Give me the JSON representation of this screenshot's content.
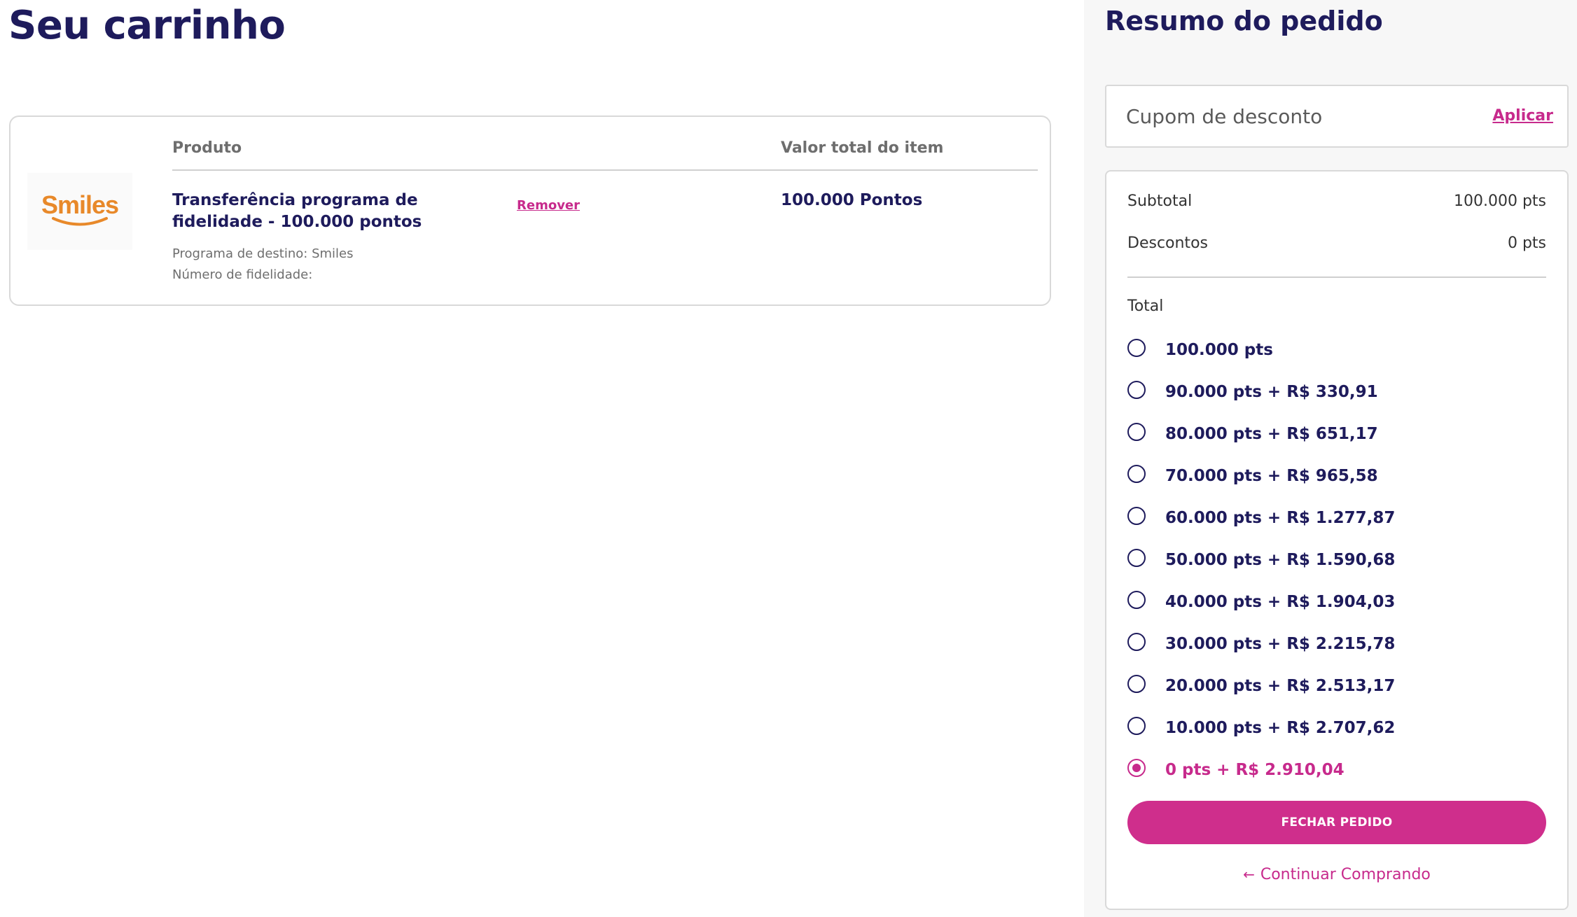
{
  "cart": {
    "title": "Seu carrinho",
    "headers": {
      "product": "Produto",
      "value": "Valor total do item"
    },
    "item": {
      "logo_text": "Smiles",
      "name": "Transferência programa de fidelidade - 100.000 pontos",
      "remove_label": "Remover",
      "value": "100.000 Pontos",
      "destination": "Programa de destino: Smiles",
      "loyalty_number": "Número de fidelidade:"
    }
  },
  "summary": {
    "title": "Resumo do pedido",
    "coupon": {
      "placeholder": "Cupom de desconto",
      "value": "",
      "apply_label": "Aplicar"
    },
    "subtotal_label": "Subtotal",
    "subtotal_value": "100.000 pts",
    "discount_label": "Descontos",
    "discount_value": "0 pts",
    "total_label": "Total",
    "options": [
      {
        "label": "100.000 pts",
        "selected": false
      },
      {
        "label": "90.000 pts + R$ 330,91",
        "selected": false
      },
      {
        "label": "80.000 pts + R$ 651,17",
        "selected": false
      },
      {
        "label": "70.000 pts + R$ 965,58",
        "selected": false
      },
      {
        "label": "60.000 pts + R$ 1.277,87",
        "selected": false
      },
      {
        "label": "50.000 pts + R$ 1.590,68",
        "selected": false
      },
      {
        "label": "40.000 pts + R$ 1.904,03",
        "selected": false
      },
      {
        "label": "30.000 pts + R$ 2.215,78",
        "selected": false
      },
      {
        "label": "20.000 pts + R$ 2.513,17",
        "selected": false
      },
      {
        "label": "10.000 pts + R$ 2.707,62",
        "selected": false
      },
      {
        "label": "0 pts + R$ 2.910,04",
        "selected": true
      }
    ],
    "checkout_label": "FECHAR PEDIDO",
    "continue_label": "Continuar Comprando"
  },
  "colors": {
    "brand_navy": "#1e1b5c",
    "accent_magenta": "#cf2e8c",
    "smiles_orange": "#e8892a"
  },
  "icons": {
    "back_arrow": "arrow-left-icon",
    "radio": "radio-icon"
  }
}
